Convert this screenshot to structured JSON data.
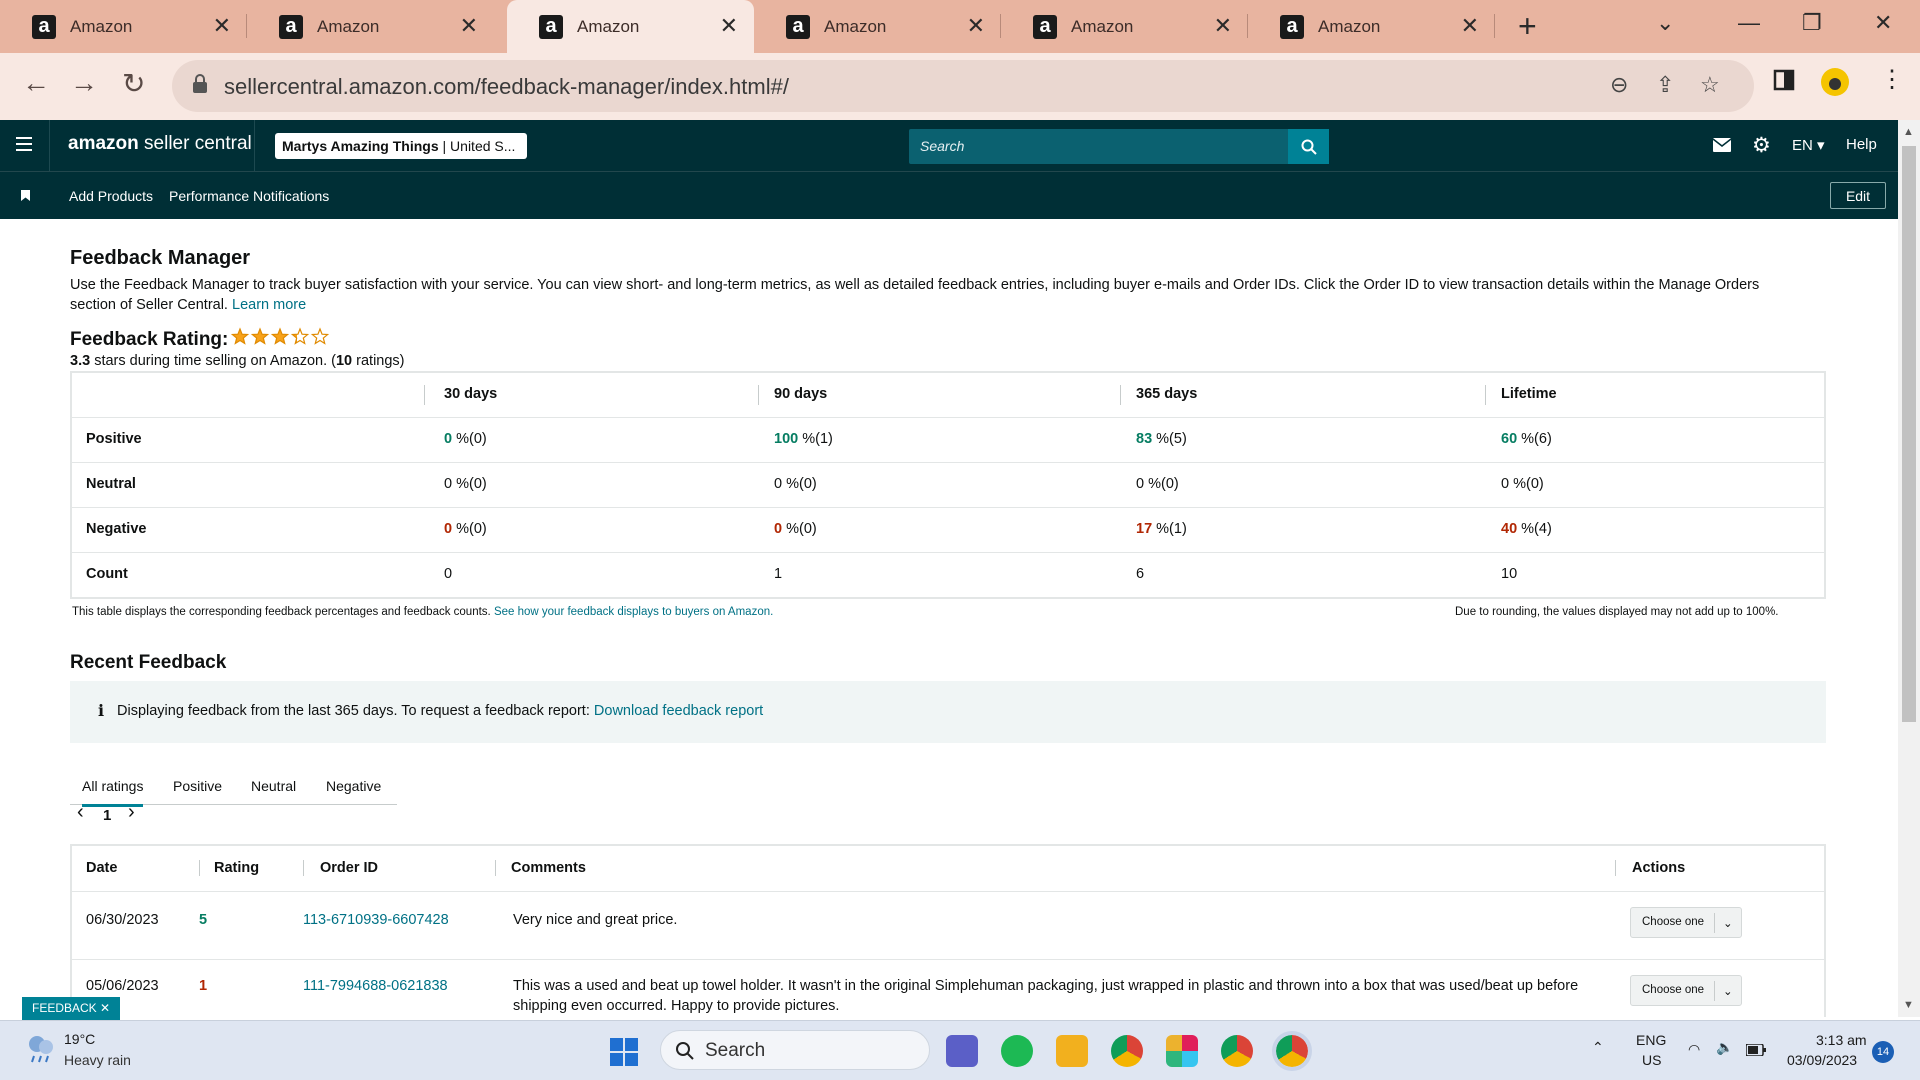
{
  "browser": {
    "tabs": [
      {
        "title": "Amazon"
      },
      {
        "title": "Amazon"
      },
      {
        "title": "Amazon"
      },
      {
        "title": "Amazon"
      },
      {
        "title": "Amazon"
      },
      {
        "title": "Amazon"
      }
    ],
    "active_tab_index": 2,
    "url": "sellercentral.amazon.com/feedback-manager/index.html#/"
  },
  "header": {
    "logo_bold": "amazon",
    "logo_rest": " seller central",
    "store_name": "Martys Amazing Things",
    "store_region": " | United S...",
    "search_placeholder": "Search",
    "language": "EN",
    "help": "Help",
    "nav_links": [
      "Add Products",
      "Performance Notifications"
    ],
    "edit": "Edit"
  },
  "page": {
    "title": "Feedback Manager",
    "description": "Use the Feedback Manager to track buyer satisfaction with your service. You can view short- and long-term metrics, as well as detailed feedback entries, including buyer e-mails and Order IDs. Click the Order ID to view transaction details within the Manage Orders section of Seller Central.",
    "learn_more": "Learn more",
    "rating_label": "Feedback Rating:",
    "rating_value": 3.3,
    "rating_stars_text": "3.3",
    "rating_sub_mid": " stars during time selling on Amazon. (",
    "rating_count": "10",
    "rating_sub_end": " ratings)"
  },
  "metrics": {
    "columns": [
      "30 days",
      "90 days",
      "365 days",
      "Lifetime"
    ],
    "rows": [
      {
        "label": "Positive",
        "cells": [
          {
            "v": "0",
            "s": " %(0)"
          },
          {
            "v": "100",
            "s": " %(1)"
          },
          {
            "v": "83",
            "s": " %(5)"
          },
          {
            "v": "60",
            "s": " %(6)"
          }
        ]
      },
      {
        "label": "Neutral",
        "cells": [
          {
            "v": "0",
            "s": " %(0)"
          },
          {
            "v": "0",
            "s": " %(0)"
          },
          {
            "v": "0",
            "s": " %(0)"
          },
          {
            "v": "0",
            "s": " %(0)"
          }
        ]
      },
      {
        "label": "Negative",
        "cells": [
          {
            "v": "0",
            "s": " %(0)"
          },
          {
            "v": "0",
            "s": " %(0)"
          },
          {
            "v": "17",
            "s": " %(1)"
          },
          {
            "v": "40",
            "s": " %(4)"
          }
        ]
      },
      {
        "label": "Count",
        "cells": [
          {
            "v": "0",
            "s": ""
          },
          {
            "v": "1",
            "s": ""
          },
          {
            "v": "6",
            "s": ""
          },
          {
            "v": "10",
            "s": ""
          }
        ]
      }
    ],
    "note_left": "This table displays the corresponding feedback percentages and feedback counts.",
    "note_link": "See how your feedback displays to buyers on Amazon.",
    "note_right": "Due to rounding, the values displayed may not add up to 100%."
  },
  "recent": {
    "title": "Recent Feedback",
    "info_icon": "i",
    "info_text": "Displaying feedback from the last 365 days. To request a feedback report:",
    "info_link": "Download feedback report",
    "filter_tabs": [
      "All ratings",
      "Positive",
      "Neutral",
      "Negative"
    ],
    "page_prev": "‹",
    "page_current": "1",
    "page_next": "›",
    "columns": [
      "Date",
      "Rating",
      "Order ID",
      "Comments",
      "Actions"
    ],
    "rows": [
      {
        "date": "06/30/2023",
        "rating": "5",
        "order_id": "113-6710939-6607428",
        "comment": "Very nice and great price.",
        "action": "Choose one"
      },
      {
        "date": "05/06/2023",
        "rating": "1",
        "order_id": "111-7994688-0621838",
        "comment": "This was a used and beat up towel holder. It wasn't in the original Simplehuman packaging, just wrapped in plastic and thrown into a box that was used/beat up before shipping even occurred. Happy to provide pictures.",
        "action": "Choose one"
      }
    ],
    "feedback_tag": "FEEDBACK ✕"
  },
  "taskbar": {
    "temp": "19°C",
    "weather": "Heavy rain",
    "search": "Search",
    "lang1": "ENG",
    "lang2": "US",
    "time": "3:13 am",
    "date": "03/09/2023",
    "notifications": "14"
  },
  "colors": {
    "positive": "#067d62",
    "negative": "#b12704",
    "link": "#007185",
    "header_bg": "#002f36"
  }
}
